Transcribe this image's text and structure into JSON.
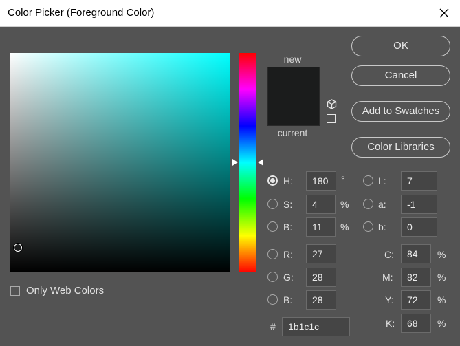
{
  "window": {
    "title": "Color Picker (Foreground Color)"
  },
  "buttons": {
    "ok": "OK",
    "cancel": "Cancel",
    "add_to_swatches": "Add to Swatches",
    "color_libraries": "Color Libraries"
  },
  "preview": {
    "new_label": "new",
    "current_label": "current",
    "new_color": "#1b1c1c",
    "current_color": "#1b1c1c"
  },
  "hsb": {
    "h": {
      "label": "H:",
      "value": "180",
      "unit": "°",
      "selected": true
    },
    "s": {
      "label": "S:",
      "value": "4",
      "unit": "%"
    },
    "b": {
      "label": "B:",
      "value": "11",
      "unit": "%"
    }
  },
  "rgb": {
    "r": {
      "label": "R:",
      "value": "27"
    },
    "g": {
      "label": "G:",
      "value": "28"
    },
    "b": {
      "label": "B:",
      "value": "28"
    }
  },
  "lab": {
    "l": {
      "label": "L:",
      "value": "7"
    },
    "a": {
      "label": "a:",
      "value": "-1"
    },
    "b": {
      "label": "b:",
      "value": "0"
    }
  },
  "cmyk": {
    "c": {
      "label": "C:",
      "value": "84",
      "unit": "%"
    },
    "m": {
      "label": "M:",
      "value": "82",
      "unit": "%"
    },
    "y": {
      "label": "Y:",
      "value": "72",
      "unit": "%"
    },
    "k": {
      "label": "K:",
      "value": "68",
      "unit": "%"
    }
  },
  "hex": {
    "label": "#",
    "value": "1b1c1c"
  },
  "only_web_colors": {
    "label": "Only Web Colors",
    "checked": false
  },
  "colors": {
    "field_hue": "#00ffff",
    "dialog_bg": "#535353"
  }
}
